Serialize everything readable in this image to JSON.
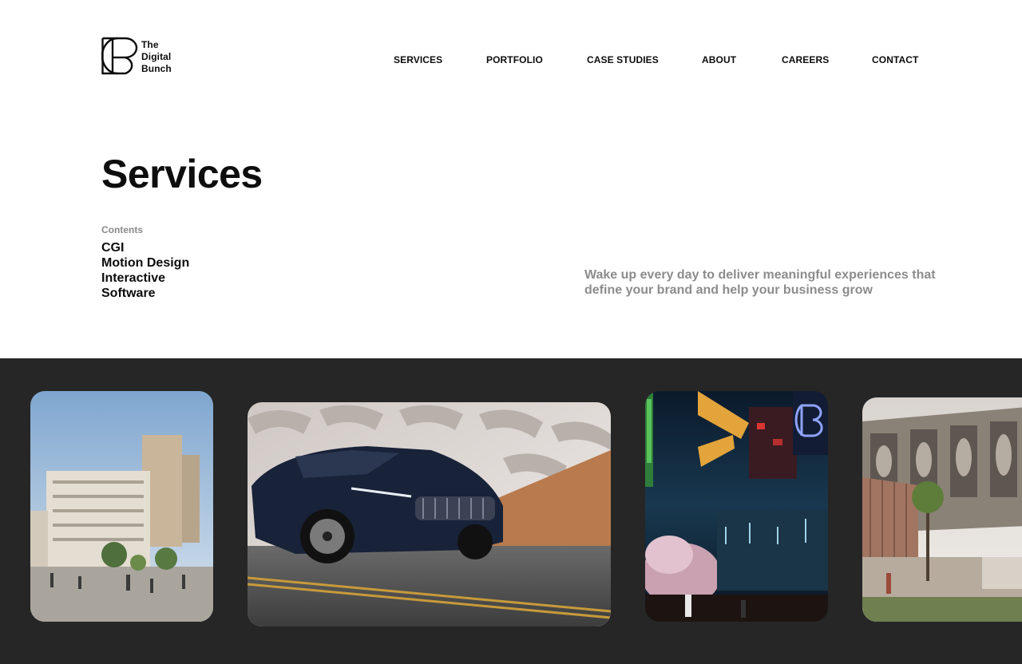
{
  "brand": {
    "name_lines": [
      "The",
      "Digital",
      "Bunch"
    ]
  },
  "nav": [
    {
      "label": "SERVICES"
    },
    {
      "label": "PORTFOLIO"
    },
    {
      "label": "CASE STUDIES"
    },
    {
      "label": "ABOUT"
    },
    {
      "label": "CAREERS"
    },
    {
      "label": "CONTACT"
    }
  ],
  "page": {
    "title": "Services",
    "contents_label": "Contents",
    "contents": [
      "CGI",
      "Motion Design",
      "Interactive",
      "Software"
    ],
    "tagline": "Wake up every day to deliver meaningful experiences that define your brand and help your business grow"
  },
  "colors": {
    "text": "#0d0d0d",
    "muted": "#8c8c8c",
    "gallery_background": "#262626"
  },
  "gallery": [
    {
      "name": "residential-architecture-render"
    },
    {
      "name": "dark-blue-sedan-render"
    },
    {
      "name": "neon-night-street-render"
    },
    {
      "name": "modern-building-exterior-render"
    }
  ]
}
